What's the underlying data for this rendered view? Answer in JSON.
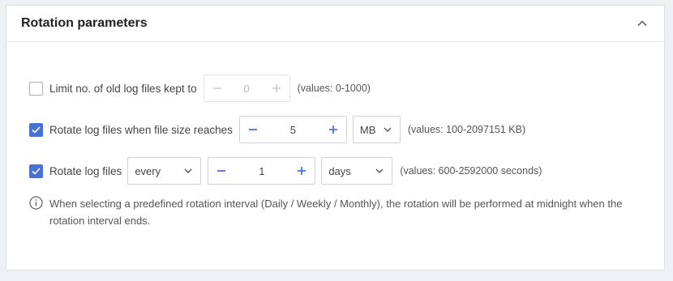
{
  "panel": {
    "title": "Rotation parameters"
  },
  "rows": {
    "limit": {
      "checked": false,
      "label": "Limit no. of old log files kept to",
      "value": "0",
      "hint": "(values: 0-1000)"
    },
    "size": {
      "checked": true,
      "label": "Rotate log files when file size reaches",
      "value": "5",
      "unit": "MB",
      "hint": "(values: 100-2097151 KB)"
    },
    "time": {
      "checked": true,
      "label": "Rotate log files",
      "mode": "every",
      "value": "1",
      "unit": "days",
      "hint": "(values: 600-2592000 seconds)"
    }
  },
  "info": {
    "icon": "info-icon",
    "text": "When selecting a predefined rotation interval (Daily / Weekly / Monthly), the rotation will be performed at midnight when the rotation interval ends."
  },
  "colors": {
    "accent": "#4a72d6"
  }
}
